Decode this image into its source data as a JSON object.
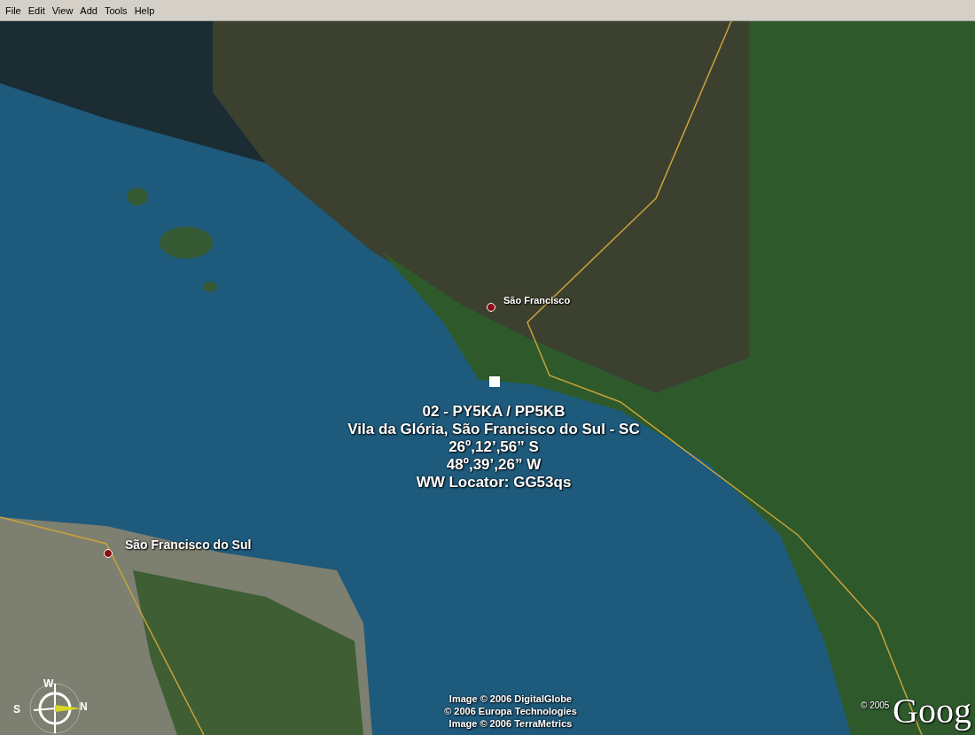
{
  "menu": [
    {
      "label": "File"
    },
    {
      "label": "Edit"
    },
    {
      "label": "View"
    },
    {
      "label": "Add"
    },
    {
      "label": "Tools"
    },
    {
      "label": "Help"
    }
  ],
  "places": [
    {
      "name": "São Francisco",
      "kind": "town"
    },
    {
      "name": "São Francisco do Sul",
      "kind": "city"
    }
  ],
  "marker_caption": [
    "02 - PY5KA / PP5KB",
    "Vila da Glória, São Francisco do Sul - SC",
    "26º,12’,56” S",
    "48º,39’,26” W",
    "WW Locator: GG53qs"
  ],
  "compass": {
    "labels": [
      "W",
      "S",
      "N"
    ]
  },
  "attribution": [
    "Image © 2006 DigitalGlobe",
    "© 2006 Europa Technologies",
    "Image © 2006 TerraMetrics"
  ],
  "logo": {
    "copyright": "© 2005",
    "text": "Goog"
  }
}
